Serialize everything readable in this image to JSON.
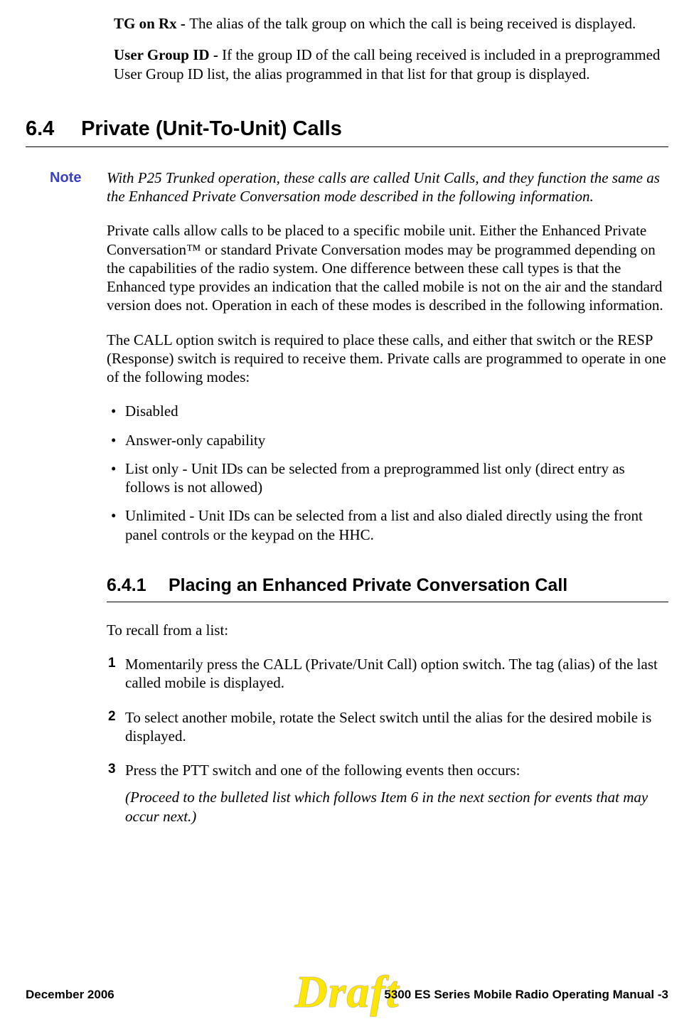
{
  "intro": {
    "p1_label": "TG on Rx - ",
    "p1_text": "The alias of the talk group on which the call is being received is displayed.",
    "p2_label": "User Group ID - ",
    "p2_text": "If the group ID of the call being received is included in a preprogrammed User Group ID list, the alias programmed in that list for that group is displayed."
  },
  "section": {
    "num": "6.4",
    "title": "Private (Unit-To-Unit) Calls"
  },
  "note": {
    "label": "Note",
    "text": "With P25 Trunked operation, these calls are called Unit Calls, and they function the same as the Enhanced Private Conversation mode described in the following information."
  },
  "body": {
    "p1": "Private calls allow calls to be placed to a specific mobile unit. Either the Enhanced Private Conversation™ or standard Private Conversation modes may be programmed depending on the capabilities of the radio system. One difference between these call types is that the Enhanced type provides an indication that the called mobile is not on the air and the standard version does not. Operation in each of these modes is described in the following information.",
    "p2": "The CALL option switch is required to place these calls, and either that switch or the RESP (Response) switch is required to receive them. Private calls are programmed to operate in one of the following modes:"
  },
  "bullets": [
    "Disabled",
    "Answer-only capability",
    "List only - Unit IDs can be selected from a preprogrammed list only (direct entry as follows is not allowed)",
    "Unlimited - Unit IDs can be selected from a list and also dialed directly using the front panel controls or the keypad on the HHC."
  ],
  "subsection": {
    "num": "6.4.1",
    "title": "Placing an Enhanced Private Conversation Call"
  },
  "recall_intro": "To recall from a list:",
  "steps": [
    {
      "text": "Momentarily press the CALL (Private/Unit Call) option switch. The tag (alias) of the last called mobile is displayed."
    },
    {
      "text": "To select another mobile, rotate the Select switch until the alias for the desired mobile is displayed."
    },
    {
      "text": "Press the PTT switch and one of the following events then occurs:",
      "follow": "(Proceed to the bulleted list which follows Item 6 in the next section for events that may occur next.)"
    }
  ],
  "footer": {
    "left": "December 2006",
    "right": "5300 ES Series Mobile Radio Operating Manual    -3"
  },
  "watermark": "Draft"
}
